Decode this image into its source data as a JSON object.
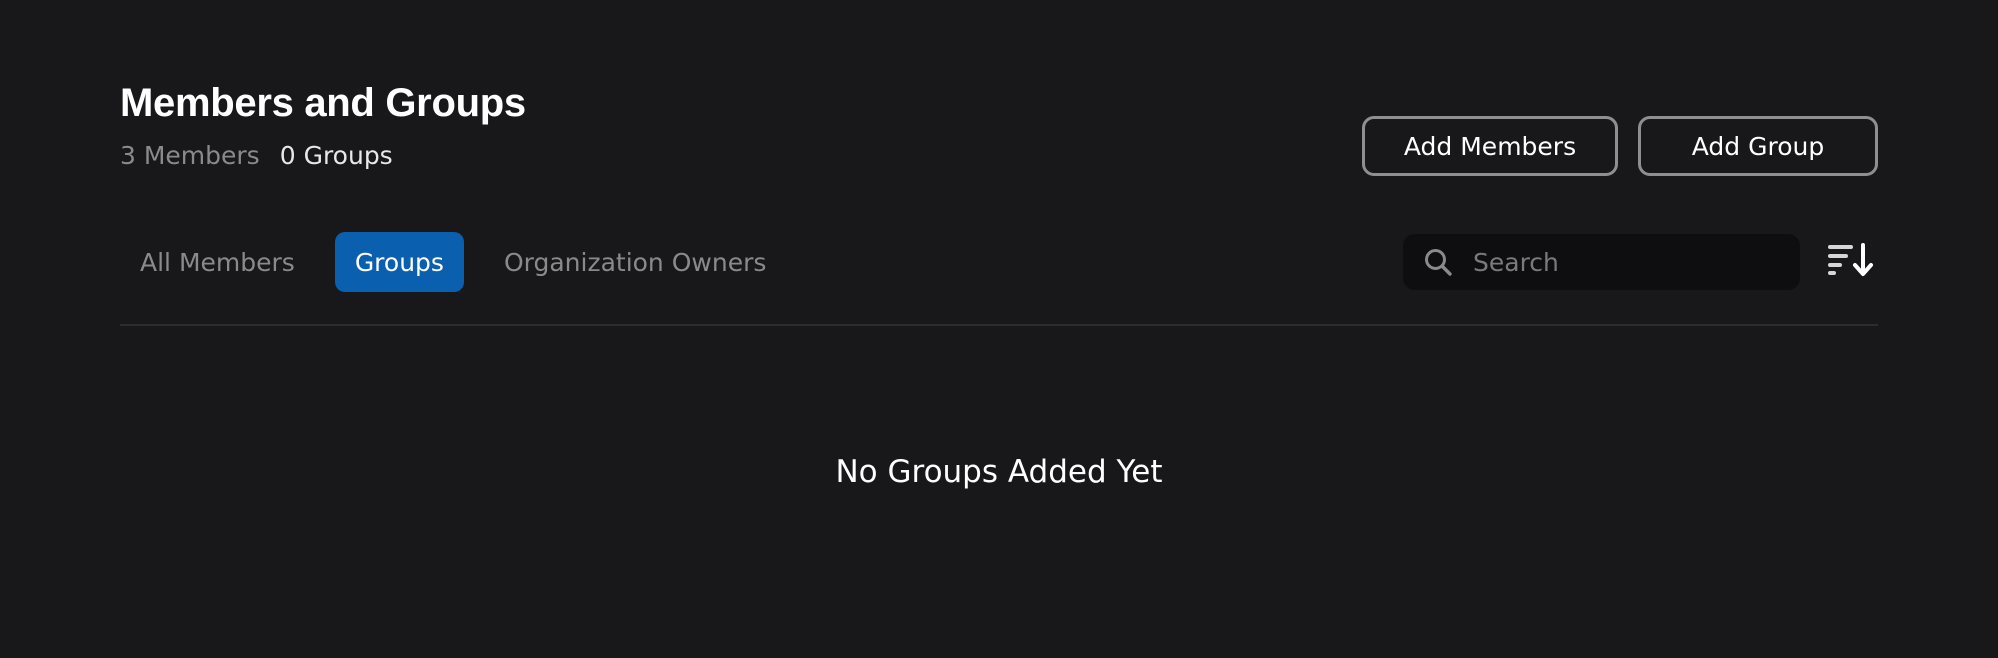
{
  "header": {
    "title": "Members and Groups",
    "members_count": "3 Members",
    "groups_count": "0 Groups"
  },
  "actions": {
    "add_members_label": "Add Members",
    "add_group_label": "Add Group"
  },
  "tabs": [
    {
      "label": "All Members",
      "active": false
    },
    {
      "label": "Groups",
      "active": true
    },
    {
      "label": "Organization Owners",
      "active": false
    }
  ],
  "search": {
    "placeholder": "Search",
    "value": "",
    "icon": "search-icon"
  },
  "sort": {
    "icon": "sort-descending-icon"
  },
  "empty_state": {
    "message": "No Groups Added Yet"
  },
  "colors": {
    "background": "#18181a",
    "active_tab": "#0a5fae",
    "button_border": "#8f8f93",
    "muted_text": "#8a8a8e",
    "search_bg": "#0e0e10"
  }
}
